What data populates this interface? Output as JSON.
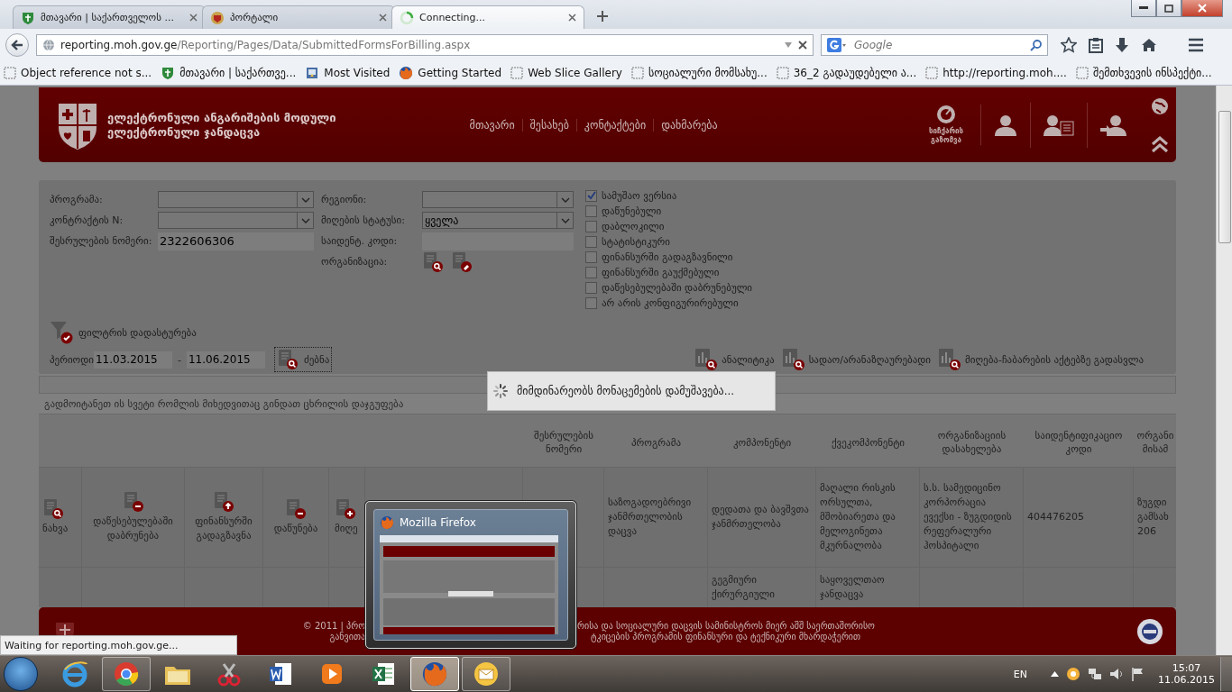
{
  "browser": {
    "tabs": [
      {
        "title": "მთავარი  | საქართველოს ...",
        "kind": "shield",
        "selected": false
      },
      {
        "title": "პორტალი",
        "kind": "emblem",
        "selected": false
      },
      {
        "title": "Connecting...",
        "kind": "spinner",
        "selected": true
      }
    ],
    "address_host": "reporting.moh.gov.ge",
    "address_path": "/Reporting/Pages/Data/SubmittedFormsForBilling.aspx",
    "search_placeholder": "Google",
    "bookmarks": [
      {
        "label": "Object reference not s...",
        "kind": "blank"
      },
      {
        "label": "მთავარი  | საქართვე...",
        "kind": "shield"
      },
      {
        "label": "Most Visited",
        "kind": "folder"
      },
      {
        "label": "Getting Started",
        "kind": "firefox"
      },
      {
        "label": "Web Slice Gallery",
        "kind": "blank"
      },
      {
        "label": "სოციალური მომსახუ...",
        "kind": "blank"
      },
      {
        "label": "36_2 გადაუდებელი ა...",
        "kind": "blank"
      },
      {
        "label": "http://reporting.moh....",
        "kind": "blank"
      },
      {
        "label": "შემთხვევის ინსპექტი...",
        "kind": "blank"
      }
    ]
  },
  "site": {
    "title_lines": [
      "ელექტრონული ანგარიშების მოდული",
      "ელექტრონული ჯანდაცვა"
    ],
    "nav": [
      "მთავარი",
      "შესახებ",
      "კონტაქტები",
      "დახმარება"
    ],
    "speed_test": "სიჩქარის გაზომვა"
  },
  "filters": {
    "left": [
      {
        "label": "პროგრამა:",
        "kind": "select"
      },
      {
        "label": "კონტრაქტის N:",
        "kind": "select"
      },
      {
        "label": "შესრულების ნომერი:",
        "kind": "text",
        "value": "2322606306"
      }
    ],
    "right": [
      {
        "label": "რეგიონი:",
        "kind": "select"
      },
      {
        "label": "მიღების სტატუსი:",
        "kind": "select",
        "value": "ყველა"
      },
      {
        "label": "საიდენტ. კოდი:",
        "kind": "text"
      },
      {
        "label": "ორგანიზაცია:",
        "kind": "icons"
      }
    ],
    "checkboxes": [
      {
        "label": "სამუშაო ვერსია",
        "checked": true
      },
      {
        "label": "დაწუნებული",
        "checked": false
      },
      {
        "label": "დაბლოკილი",
        "checked": false
      },
      {
        "label": "სტატისტიკური",
        "checked": false
      },
      {
        "label": "ფინანსურში გადაგზავნილი",
        "checked": false
      },
      {
        "label": "ფინანსურში გაუქმებული",
        "checked": false
      },
      {
        "label": "დაწესებულებაში დაბრუნებული",
        "checked": false
      },
      {
        "label": "არ არის კონფიგურირებული",
        "checked": false
      }
    ],
    "confirm": "ფილტრის დადასტურება",
    "period": {
      "label": "პერიოდი",
      "from": "11.03.2015",
      "separator": "-",
      "to": "11.06.2015"
    },
    "search_button": "ძებნა",
    "reports": [
      "ანალიტიკა",
      "სადაო/არანაზღაურებადი",
      "მიღება-ჩაბარების აქტებზე გადასვლა"
    ]
  },
  "loading": "მიმდინარეობს მონაცემების დამუშავება...",
  "table": {
    "group_hint": "გადმოიტანეთ ის სვეტი რომლის მიხედვითაც გინდათ ცხრილის დაჯგუფება",
    "columns": [
      "შესრულების ნომერი",
      "პროგრამა",
      "კომპონენტი",
      "ქვეკომპონენტი",
      "ორგანიზაციის დასახელება",
      "საიდენტიფიკაციო კოდი",
      "ორგანი მისამ"
    ],
    "rows": [
      {
        "actions": [
          {
            "label": "ნახვა",
            "kind": "view"
          },
          {
            "label": "დაწესებულებაში დაბრუნება",
            "kind": "minus"
          },
          {
            "label": "ფინანსურში გადაგზავნა",
            "kind": "up"
          },
          {
            "label": "დაწუნება",
            "kind": "minus"
          },
          {
            "label": "მიღე",
            "kind": "plus"
          }
        ],
        "cells": [
          null,
          "საზოგადოებრივი ჯანმრთელობის დაცვა",
          "დედათა და ბავშვთა ჯანმრთელობა",
          "მაღალი რისკის ორსულთა, მშობიარეთა და მელოგინეთა მკურნალობა",
          "ს.ს. სამედიცინო კორპორაცია ევექსი - ზუგდიდის რეფერალური ჰოსპიტალი",
          "404476205",
          "ზუგდი გამსახ 206"
        ]
      },
      {
        "actions": [],
        "cells": [
          null,
          null,
          "გეგმიური ქირურგიული",
          "საყოველთაო ჯანდაცვა",
          null,
          null,
          null
        ]
      }
    ]
  },
  "footer": {
    "lines": [
      {
        "left": "© 2011 | პრო",
        "right": "რისა და სოციალური დაცვის სამინისტროს მიერ აშშ საერთაშორისო"
      },
      {
        "left": "განვითა",
        "right": "ტკიცების პროგრამის ფინანსური და ტექნიკური მხარდაჭერით"
      }
    ]
  },
  "status": "Waiting for reporting.moh.gov.ge...",
  "thumbnail": {
    "title": "Mozilla Firefox"
  },
  "taskbar": {
    "apps": [
      {
        "kind": "ie",
        "running": false,
        "selected": false
      },
      {
        "kind": "chrome",
        "running": true,
        "selected": false
      },
      {
        "kind": "folder",
        "running": false,
        "selected": false
      },
      {
        "kind": "scissors",
        "running": false,
        "selected": false
      },
      {
        "kind": "word",
        "running": false,
        "selected": false
      },
      {
        "kind": "media",
        "running": false,
        "selected": false
      },
      {
        "kind": "excel",
        "running": false,
        "selected": false
      },
      {
        "kind": "firefox",
        "running": true,
        "selected": true
      },
      {
        "kind": "mail",
        "running": true,
        "selected": false
      }
    ],
    "language": "EN",
    "time": "15:07",
    "date": "11.06.2015"
  }
}
